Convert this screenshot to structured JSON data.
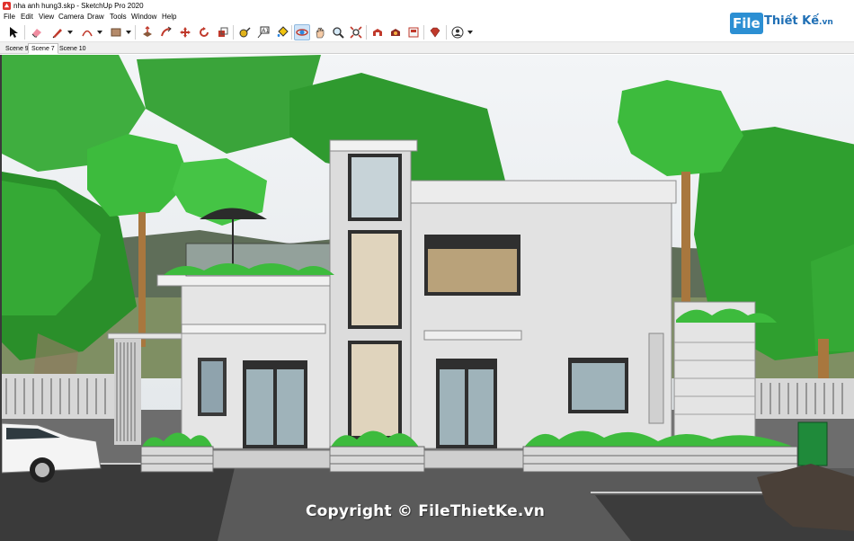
{
  "window": {
    "title": "nha anh hung3.skp - SketchUp Pro 2020"
  },
  "menu": {
    "items": [
      "File",
      "Edit",
      "View",
      "Camera",
      "Draw",
      "Tools",
      "Window",
      "Help"
    ]
  },
  "toolbar": {
    "tools": [
      {
        "name": "select-tool",
        "icon": "arrow-cursor-icon"
      },
      {
        "name": "eraser-tool",
        "icon": "eraser-icon"
      },
      {
        "name": "line-tool",
        "icon": "pencil-icon"
      },
      {
        "name": "arc-tool",
        "icon": "arc-icon"
      },
      {
        "name": "rectangle-tool",
        "icon": "rectangle-icon"
      },
      {
        "name": "push-pull-tool",
        "icon": "push-pull-icon"
      },
      {
        "name": "follow-me-tool",
        "icon": "follow-me-icon"
      },
      {
        "name": "move-tool",
        "icon": "move-icon"
      },
      {
        "name": "rotate-tool",
        "icon": "rotate-icon"
      },
      {
        "name": "scale-tool",
        "icon": "scale-icon"
      },
      {
        "name": "offset-tool",
        "icon": "offset-icon"
      },
      {
        "name": "tape-measure-tool",
        "icon": "tape-measure-icon"
      },
      {
        "name": "text-tool",
        "icon": "text-icon"
      },
      {
        "name": "paint-bucket-tool",
        "icon": "paint-bucket-icon"
      },
      {
        "name": "orbit-tool",
        "icon": "orbit-icon"
      },
      {
        "name": "pan-tool",
        "icon": "pan-hand-icon"
      },
      {
        "name": "zoom-tool",
        "icon": "zoom-icon"
      },
      {
        "name": "zoom-extents-tool",
        "icon": "zoom-extents-icon"
      },
      {
        "name": "3d-warehouse",
        "icon": "warehouse-icon"
      },
      {
        "name": "extension-warehouse",
        "icon": "extension-warehouse-icon"
      },
      {
        "name": "layout",
        "icon": "layout-icon"
      },
      {
        "name": "extension-manager",
        "icon": "ruby-gem-icon"
      },
      {
        "name": "account",
        "icon": "user-account-icon"
      }
    ],
    "active_tool": "orbit-tool"
  },
  "logo": {
    "box_text": "File",
    "brand_text": "Thiết Kế",
    "suffix": ".vn",
    "accent": "#2c8fd3"
  },
  "scenes": {
    "tabs": [
      "Scene 9",
      "Scene 7",
      "Scene 10"
    ],
    "active_index": 1
  },
  "viewport": {
    "watermark": "Copyright © FileThietKe.vn",
    "sky_color": "#e9edf0",
    "foliage_color": "#3cad3c",
    "wall_color": "#e3e3e3"
  }
}
